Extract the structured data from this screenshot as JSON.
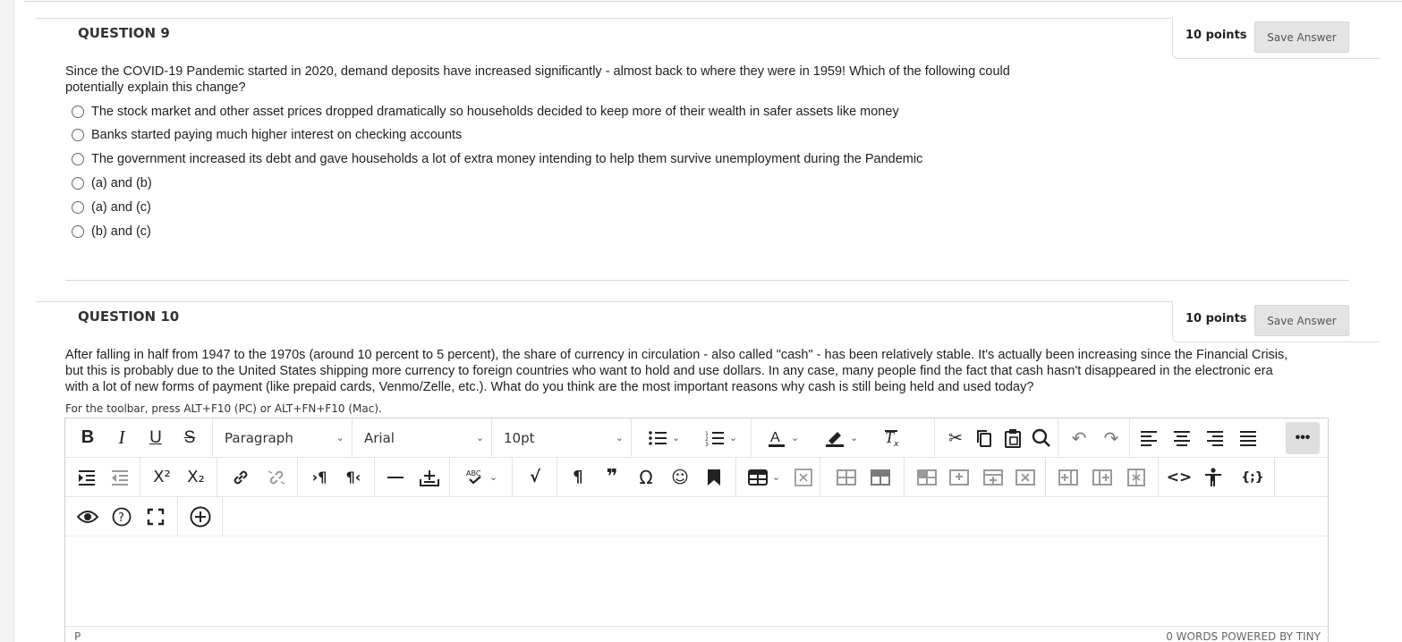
{
  "question9": {
    "title": "QUESTION 9",
    "points": "10 points",
    "save_label": "Save Answer",
    "text_line1": "Since the COVID-19 Pandemic started in 2020, demand deposits have increased significantly - almost back to where they were in 1959! Which of the following could",
    "text_line2": "potentially explain this change?",
    "options": [
      "The stock market and other asset prices dropped dramatically so households decided to keep more of their wealth in safer assets like money",
      "Banks started paying much higher interest on checking accounts",
      "The government increased its debt and gave households a lot of extra money intending to help them survive unemployment during the Pandemic",
      "(a) and (b)",
      "(a) and (c)",
      "(b) and (c)"
    ]
  },
  "question10": {
    "title": "QUESTION 10",
    "points": "10 points",
    "save_label": "Save Answer",
    "text_line1": "After falling in half from 1947 to the 1970s (around 10 percent to 5 percent), the share of currency in circulation - also called \"cash\" - has been relatively stable. It's actually been increasing since the Financial Crisis,",
    "text_line2": "but this is probably due to the United States shipping more currency to foreign countries who want to hold and use dollars. In any case, many people find the fact that cash hasn't disappeared in the electronic era",
    "text_line3": "with a lot of new forms of payment (like prepaid cards, Venmo/Zelle, etc.). What do you think are the most important reasons why cash is still being held and used today?",
    "toolbar_hint": "For the toolbar, press ALT+F10 (PC) or ALT+FN+F10 (Mac)."
  },
  "editor": {
    "bold": "B",
    "italic": "I",
    "underline": "U",
    "strike": "S",
    "block_format": "Paragraph",
    "font_family": "Arial",
    "font_size": "10pt",
    "more": "•••",
    "status_path": "P",
    "status_right": "0 WORDS  POWERED BY TINY"
  }
}
